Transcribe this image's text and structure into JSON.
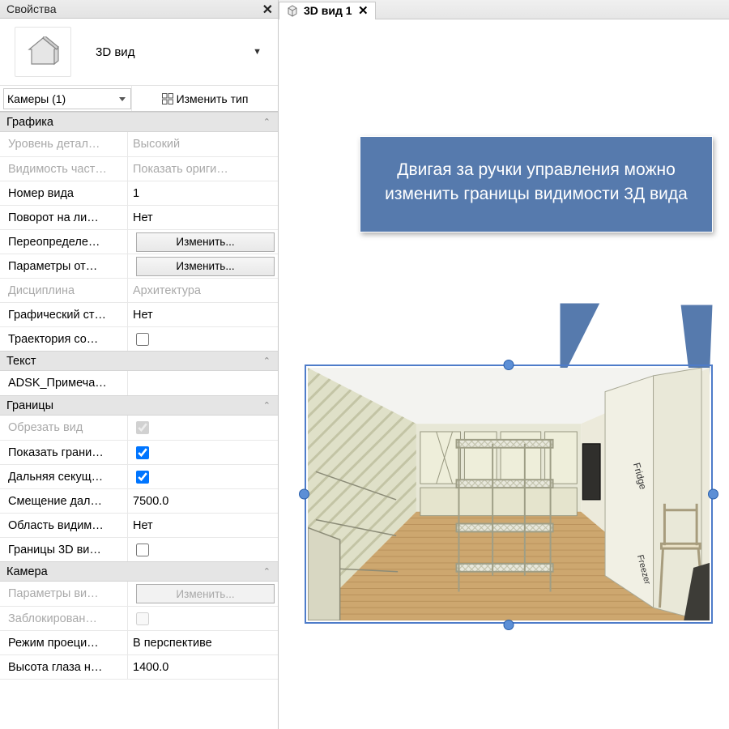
{
  "panel": {
    "title": "Свойства",
    "type_label": "3D вид",
    "selector_value": "Камеры (1)",
    "edit_type_label": "Изменить тип"
  },
  "groups": {
    "graphics": {
      "header": "Графика",
      "exp": "⌃⌄",
      "rows": [
        {
          "label": "Уровень детал…",
          "value": "Высокий",
          "disabled": true
        },
        {
          "label": "Видимость част…",
          "value": "Показать ориги…",
          "disabled": true
        },
        {
          "label": "Номер вида",
          "value": "1"
        },
        {
          "label": "Поворот на ли…",
          "value": "Нет"
        },
        {
          "label": "Переопределе…",
          "btn": "Изменить..."
        },
        {
          "label": "Параметры от…",
          "btn": "Изменить..."
        },
        {
          "label": "Дисциплина",
          "value": "Архитектура",
          "disabled": true
        },
        {
          "label": "Графический ст…",
          "value": "Нет"
        },
        {
          "label": "Траектория со…",
          "checkbox": false
        }
      ]
    },
    "text": {
      "header": "Текст",
      "rows": [
        {
          "label": "ADSK_Примеча…",
          "value": ""
        }
      ]
    },
    "bounds": {
      "header": "Границы",
      "rows": [
        {
          "label": "Обрезать вид",
          "checkbox": true,
          "disabled": true
        },
        {
          "label": "Показать грани…",
          "checkbox": true
        },
        {
          "label": "Дальняя секущ…",
          "checkbox": true
        },
        {
          "label": "Смещение дал…",
          "value": "7500.0"
        },
        {
          "label": "Область видим…",
          "value": "Нет"
        },
        {
          "label": "Границы 3D ви…",
          "checkbox": false
        }
      ]
    },
    "camera": {
      "header": "Камера",
      "rows": [
        {
          "label": "Параметры ви…",
          "btn": "Изменить...",
          "disabled": true
        },
        {
          "label": "Заблокирован…",
          "checkbox": false,
          "disabled": true
        },
        {
          "label": "Режим проеци…",
          "value": "В перспективе"
        },
        {
          "label": "Высота глаза н…",
          "value": "1400.0"
        }
      ]
    }
  },
  "tab": {
    "title": "3D вид 1"
  },
  "callout": {
    "text": "Двигая за ручки управления можно изменить границы видимости 3Д вида"
  },
  "scene_labels": {
    "fridge": "Fridge",
    "freezer": "Freezer"
  }
}
